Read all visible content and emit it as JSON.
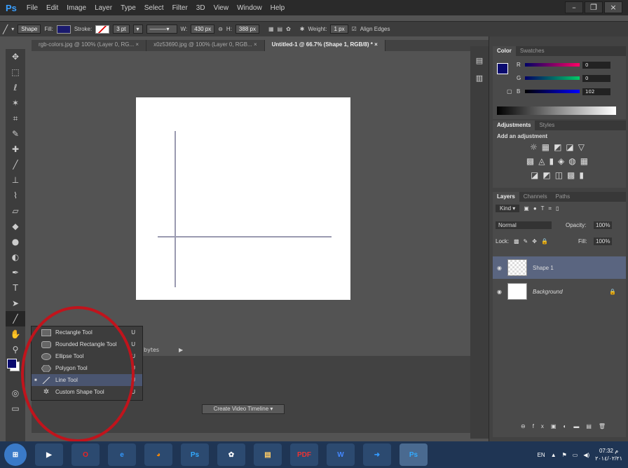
{
  "app": {
    "logo": "Ps",
    "menu": [
      "File",
      "Edit",
      "Image",
      "Layer",
      "Type",
      "Select",
      "Filter",
      "3D",
      "View",
      "Window",
      "Help"
    ],
    "window_controls": [
      "–",
      "❐",
      "×"
    ]
  },
  "options_bar": {
    "mode": "Shape",
    "fill_label": "Fill:",
    "stroke_label": "Stroke:",
    "stroke_size": "3 pt",
    "w_label": "W:",
    "w_value": "430 px",
    "h_label": "H:",
    "h_value": "388 px",
    "weight_label": "Weight:",
    "weight_value": "1 px",
    "align_edges": "Align Edges",
    "fill_color": "#1a1a6e"
  },
  "tabs": [
    {
      "label": "rgb-colors.jpg @ 100% (Layer 0, RG...",
      "active": false
    },
    {
      "label": "x0z53690.jpg @ 100% (Layer 0, RGB...",
      "active": false
    },
    {
      "label": "Untitled-1 @ 66.7% (Shape 1, RGB/8) *",
      "active": true
    }
  ],
  "tool_flyout": {
    "items": [
      {
        "label": "Rectangle Tool",
        "key": "U",
        "icon": "rectangle-icon",
        "selected": false
      },
      {
        "label": "Rounded Rectangle Tool",
        "key": "U",
        "icon": "rounded-rectangle-icon",
        "selected": false
      },
      {
        "label": "Ellipse Tool",
        "key": "U",
        "icon": "ellipse-icon",
        "selected": false
      },
      {
        "label": "Polygon Tool",
        "key": "U",
        "icon": "polygon-icon",
        "selected": false
      },
      {
        "label": "Line Tool",
        "key": "U",
        "icon": "line-icon",
        "selected": true
      },
      {
        "label": "Custom Shape Tool",
        "key": "U",
        "icon": "custom-shape-icon",
        "selected": false
      }
    ]
  },
  "timeline": {
    "button": "Create Video Timeline",
    "bytes_label": "bytes"
  },
  "color_panel": {
    "tabs": [
      "Color",
      "Swatches"
    ],
    "r": "0",
    "g": "0",
    "b": "102",
    "r_label": "R",
    "g_label": "G",
    "b_label": "B",
    "fg_color": "#0a0a6e"
  },
  "adjustments_panel": {
    "tabs": [
      "Adjustments",
      "Styles"
    ],
    "heading": "Add an adjustment"
  },
  "layers_panel": {
    "tabs": [
      "Layers",
      "Channels",
      "Paths"
    ],
    "kind": "Kind",
    "blend_mode": "Normal",
    "opacity_label": "Opacity:",
    "opacity": "100%",
    "lock_label": "Lock:",
    "fill_label": "Fill:",
    "fill": "100%",
    "layers": [
      {
        "name": "Shape 1",
        "selected": true
      },
      {
        "name": "Background",
        "selected": false
      }
    ]
  },
  "taskbar": {
    "apps": [
      "start",
      "media",
      "opera",
      "ie",
      "firefox",
      "photoshop",
      "paint",
      "files",
      "pdf",
      "word",
      "messenger",
      "photoshop-active"
    ],
    "lang": "EN",
    "time": "07:32 م",
    "date": "٢٠١٤/٠٢/٢١"
  }
}
